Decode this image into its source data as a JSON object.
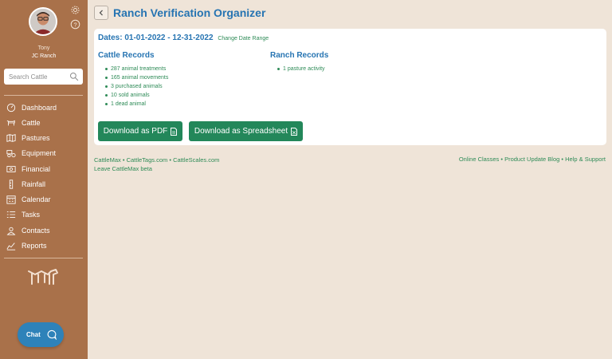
{
  "user": {
    "name": "Tony",
    "ranch": "JC Ranch"
  },
  "search": {
    "placeholder": "Search Cattle"
  },
  "nav": {
    "items": [
      {
        "label": "Dashboard",
        "icon": "dashboard-icon"
      },
      {
        "label": "Cattle",
        "icon": "cattle-icon"
      },
      {
        "label": "Pastures",
        "icon": "pastures-icon"
      },
      {
        "label": "Equipment",
        "icon": "equipment-icon"
      },
      {
        "label": "Financial",
        "icon": "financial-icon"
      },
      {
        "label": "Rainfall",
        "icon": "rainfall-icon"
      },
      {
        "label": "Calendar",
        "icon": "calendar-icon"
      },
      {
        "label": "Tasks",
        "icon": "tasks-icon"
      },
      {
        "label": "Contacts",
        "icon": "contacts-icon"
      },
      {
        "label": "Reports",
        "icon": "reports-icon"
      }
    ]
  },
  "chat": {
    "label": "Chat"
  },
  "page": {
    "title": "Ranch Verification Organizer",
    "dates": "Dates: 01-01-2022 - 12-31-2022",
    "change_range": "Change Date Range"
  },
  "cattle_records": {
    "title": "Cattle Records",
    "items": [
      "287 animal treatments",
      "165 animal movements",
      "3 purchased animals",
      "10 sold animals",
      "1 dead animal"
    ]
  },
  "ranch_records": {
    "title": "Ranch Records",
    "items": [
      "1 pasture activity"
    ]
  },
  "buttons": {
    "download_pdf": "Download as PDF",
    "download_spreadsheet": "Download as Spreadsheet"
  },
  "footer": {
    "left_links": [
      "CattleMax",
      "CattleTags.com",
      "CattleScales.com"
    ],
    "leave_beta": "Leave CattleMax beta",
    "right_links": [
      "Online Classes",
      "Product Update Blog",
      "Help & Support"
    ]
  },
  "colors": {
    "sidebar": "#a9714a",
    "background": "#efe4d8",
    "title_blue": "#2674b2",
    "link_green": "#2e8b57",
    "button_green": "#23875a",
    "chat_blue": "#2e82b9"
  }
}
